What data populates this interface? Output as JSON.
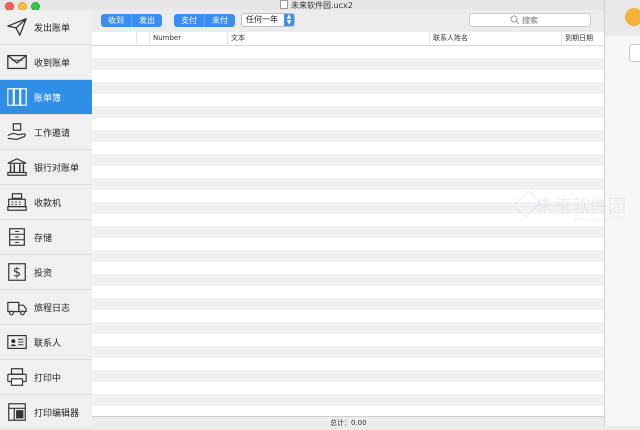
{
  "window": {
    "title": "未来软件园.ucx2"
  },
  "sidebar": {
    "items": [
      {
        "label": "发出账单",
        "icon": "paper-plane-icon"
      },
      {
        "label": "收到账单",
        "icon": "envelope-icon"
      },
      {
        "label": "账单簿",
        "icon": "binders-icon",
        "active": true
      },
      {
        "label": "工作邀请",
        "icon": "hand-box-icon"
      },
      {
        "label": "银行对账单",
        "icon": "bank-icon"
      },
      {
        "label": "收款机",
        "icon": "cash-register-icon"
      },
      {
        "label": "存储",
        "icon": "cabinet-icon"
      },
      {
        "label": "投资",
        "icon": "dollar-icon"
      },
      {
        "label": "旅程日志",
        "icon": "truck-icon"
      },
      {
        "label": "联系人",
        "icon": "contact-card-icon"
      },
      {
        "label": "打印中",
        "icon": "printer-icon"
      },
      {
        "label": "打印编辑器",
        "icon": "layout-icon"
      }
    ]
  },
  "toolbar": {
    "group1": [
      "收到",
      "发出"
    ],
    "group2": [
      "支付",
      "未付"
    ],
    "period": "任何一年",
    "search_placeholder": "搜索"
  },
  "table": {
    "columns": [
      "",
      "Number",
      "文本",
      "联系人姓名",
      "到期日期"
    ],
    "rows": []
  },
  "footer": {
    "total": "总计：0.00"
  },
  "colors": {
    "accent": "#2f8ee5",
    "button": "#3b8ef0"
  }
}
